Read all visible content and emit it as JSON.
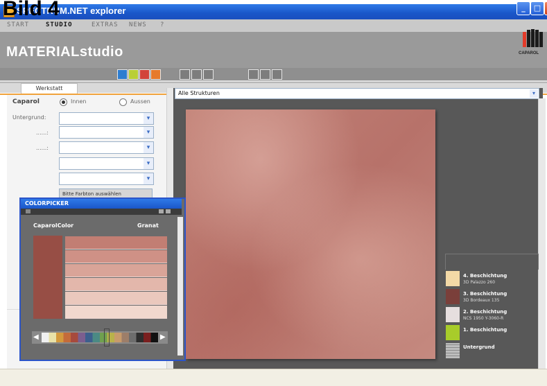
{
  "page_label": "Bild 4",
  "window": {
    "title": "SPECTRUM.NET explorer",
    "controls": {
      "minimize": "_",
      "maximize": "□",
      "close": "×"
    }
  },
  "menu": {
    "items": [
      "START",
      "STUDIO",
      "EXTRAS",
      "NEWS",
      "?"
    ],
    "active": "STUDIO"
  },
  "brand": {
    "title": "MATERIALstudio",
    "logo_text": "CAPAROL"
  },
  "tabs": {
    "werkstatt": "Werkstatt"
  },
  "form": {
    "brand_label": "Caparol",
    "radio_innen": "Innen",
    "radio_aussen": "Aussen",
    "untergrund_label": "Untergrund:",
    "row2_label": "......:",
    "row3_label": "......:",
    "farbton_button": "Bitte Farbton auswählen"
  },
  "main": {
    "struktur_value": "Alle Strukturen"
  },
  "layers": [
    {
      "title": "4. Beschichtung",
      "sub": "3D Palazzo 260",
      "color": "#f3d9a6"
    },
    {
      "title": "3. Beschichtung",
      "sub": "3D Bordeaux 135",
      "color": "#7a3f3a"
    },
    {
      "title": "2. Beschichtung",
      "sub": "NCS 1950 Y-3060-R",
      "color": "#e6dede"
    },
    {
      "title": "1. Beschichtung",
      "sub": "",
      "color": "#a8cc2a"
    },
    {
      "title": "Untergrund",
      "sub": "",
      "color": "#bdbdbd"
    }
  ],
  "colorpicker": {
    "title": "COLORPICKER",
    "collection": "CaparolColor",
    "shade_name": "Granat",
    "main_color": "#974e45",
    "shades": [
      "#c27e73",
      "#cf9186",
      "#d9a498",
      "#e3b7ab",
      "#eac8bd",
      "#f1d8ce"
    ],
    "strip_colors": [
      "#f0f0f0",
      "#e9e2a8",
      "#d49a3d",
      "#c46b3a",
      "#a74a3d",
      "#7c5e8f",
      "#3d5f8d",
      "#4b8a84",
      "#6fa04f",
      "#b9b24a",
      "#c89b6b",
      "#9d7e69",
      "#6d6d6d",
      "#2d2d2d",
      "#7a1f1f",
      "#111111"
    ]
  }
}
